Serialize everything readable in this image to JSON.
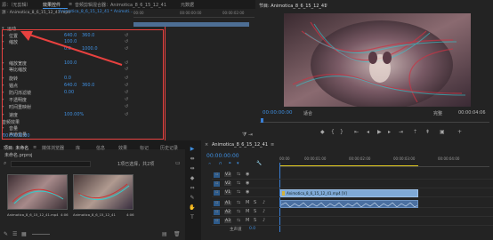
{
  "effect_controls": {
    "tabs": [
      "源：（无剪辑）",
      "效果控件",
      "音频剪辑混合器：Animotica_8_6_15_12_41",
      "元数据"
    ],
    "tab_menu": "≡",
    "clip_path": "源 · Animotica_8_6_15_12_41.mp4",
    "clip_target": "Animotica_8_6_15_12_41 * Animoti...",
    "mini_timecodes": [
      "00:00",
      "00:00:00:00",
      "00:00:02:00"
    ],
    "section_motion": "运动",
    "rows": [
      {
        "label": "位置",
        "v1": "640.0",
        "v2": "360.0"
      },
      {
        "label": "缩放",
        "v1": "100.0",
        "v2": ""
      },
      {
        "label": "",
        "v1": "0.0",
        "v2": "1000.0"
      },
      {
        "label": "缩放宽度",
        "v1": "100.0",
        "v2": ""
      },
      {
        "label": "等比缩放",
        "v1": "",
        "v2": ""
      },
      {
        "label": "旋转",
        "v1": "0.0",
        "v2": ""
      },
      {
        "label": "锚点",
        "v1": "640.0",
        "v2": "360.0"
      },
      {
        "label": "防闪烁滤镜",
        "v1": "0.00",
        "v2": ""
      },
      {
        "label": "不透明度",
        "v1": "",
        "v2": ""
      },
      {
        "label": "时间重映射",
        "v1": "",
        "v2": ""
      },
      {
        "label": "速度",
        "v1": "100.00%",
        "v2": ""
      }
    ],
    "audio_section": "音频效果",
    "audio_rows": [
      "音量",
      "声道音量"
    ],
    "bottom_time": "00:00:00:00"
  },
  "program_monitor": {
    "title": "节目: Animotica_8_6_15_12_41",
    "menu": "≡",
    "timecode": "00:00:00:00",
    "fit": "适合",
    "quality": "完整",
    "duration": "00:00:04:06"
  },
  "project_panel": {
    "tabs": [
      "项目: 未命名",
      "媒体浏览器",
      "库",
      "信息",
      "效果",
      "标记",
      "历史记录"
    ],
    "menu": "≡",
    "file": "未命名.prproj",
    "search_placeholder": "",
    "selection": "1项已选择，共2项",
    "clips": [
      {
        "name": "Animotica_8_6_15_12_41.mp4",
        "duration": "4:06"
      },
      {
        "name": "Animotica_8_6_15_12_41",
        "duration": "4:06"
      }
    ]
  },
  "timeline": {
    "tab_close": "×",
    "title": "Animotica_8_6_15_12_41",
    "menu": "≡",
    "timecode": "00:00:00:00",
    "ruler": [
      "00:00",
      "00:00:01:00",
      "00:00:02:00",
      "00:00:03:00",
      "00:00:04:00"
    ],
    "video_tracks": [
      "V3",
      "V2",
      "V1"
    ],
    "audio_tracks": [
      "A1",
      "A2",
      "A3"
    ],
    "master": "主声道",
    "master_value": "0.0",
    "clip_video": "Animotica_8_6_15_12_41.mp4 [V]",
    "tools": [
      "▶",
      "⇼",
      "⇹",
      "◆",
      "⇔",
      "✎",
      "✋",
      "T"
    ]
  },
  "colors": {
    "accent": "#3f8fe0",
    "playhead": "#3a7fd5",
    "clip_video": "#7fa9d6",
    "clip_audio": "#4a6fa0",
    "annotation": "#e8413f",
    "work_area": "#e0c820"
  }
}
